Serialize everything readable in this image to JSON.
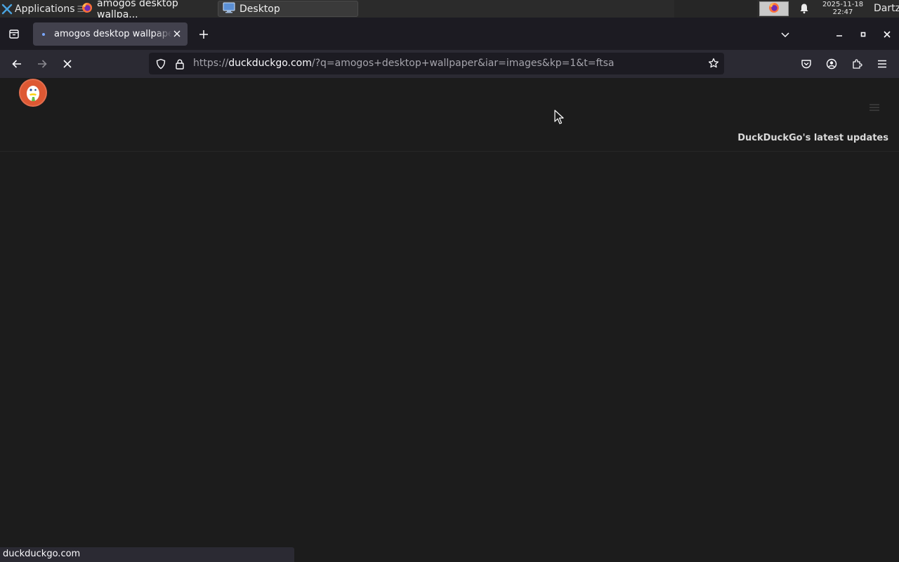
{
  "taskbar": {
    "applications_label": "Applications",
    "tasks": [
      {
        "label": "amogos desktop wallpa...",
        "icon": "firefox-icon"
      },
      {
        "label": "Desktop",
        "icon": "desktop-icon"
      }
    ],
    "clock": {
      "date": "2025-11-18",
      "time": "22:47"
    },
    "user": "Dartz"
  },
  "browser": {
    "tab": {
      "title": "amogos desktop wallpaper at DuckDuckGo",
      "state": "loading"
    },
    "url": {
      "scheme": "https://",
      "host": "duckduckgo.com",
      "path": "/?q=amogos+desktop+wallpaper&iar=images&kp=1&t=ftsa"
    },
    "status_text": "duckduckgo.com"
  },
  "page": {
    "updates_link": "DuckDuckGo's latest updates"
  },
  "colors": {
    "taskbar_bg": "#2b2b2b",
    "tab_active_bg": "#42414d",
    "navbar_bg": "#2b2a33",
    "urlbar_bg": "#1c1b22",
    "page_bg": "#1c1c1c",
    "ddg_orange": "#de5833"
  }
}
